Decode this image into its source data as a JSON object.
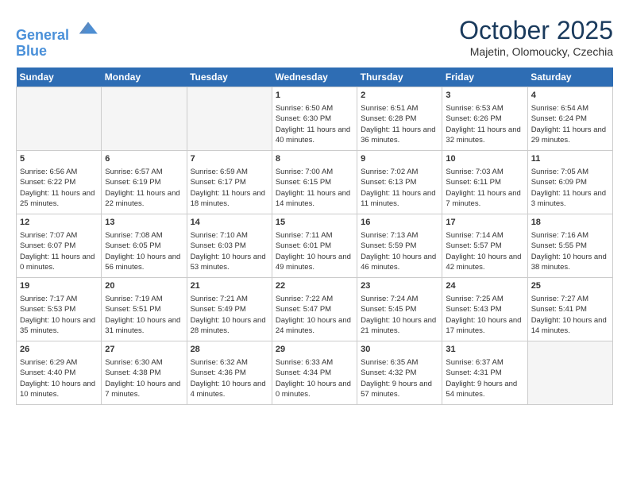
{
  "header": {
    "logo_line1": "General",
    "logo_line2": "Blue",
    "month": "October 2025",
    "location": "Majetin, Olomoucky, Czechia"
  },
  "weekdays": [
    "Sunday",
    "Monday",
    "Tuesday",
    "Wednesday",
    "Thursday",
    "Friday",
    "Saturday"
  ],
  "weeks": [
    [
      {
        "day": "",
        "info": ""
      },
      {
        "day": "",
        "info": ""
      },
      {
        "day": "",
        "info": ""
      },
      {
        "day": "1",
        "info": "Sunrise: 6:50 AM\nSunset: 6:30 PM\nDaylight: 11 hours and 40 minutes."
      },
      {
        "day": "2",
        "info": "Sunrise: 6:51 AM\nSunset: 6:28 PM\nDaylight: 11 hours and 36 minutes."
      },
      {
        "day": "3",
        "info": "Sunrise: 6:53 AM\nSunset: 6:26 PM\nDaylight: 11 hours and 32 minutes."
      },
      {
        "day": "4",
        "info": "Sunrise: 6:54 AM\nSunset: 6:24 PM\nDaylight: 11 hours and 29 minutes."
      }
    ],
    [
      {
        "day": "5",
        "info": "Sunrise: 6:56 AM\nSunset: 6:22 PM\nDaylight: 11 hours and 25 minutes."
      },
      {
        "day": "6",
        "info": "Sunrise: 6:57 AM\nSunset: 6:19 PM\nDaylight: 11 hours and 22 minutes."
      },
      {
        "day": "7",
        "info": "Sunrise: 6:59 AM\nSunset: 6:17 PM\nDaylight: 11 hours and 18 minutes."
      },
      {
        "day": "8",
        "info": "Sunrise: 7:00 AM\nSunset: 6:15 PM\nDaylight: 11 hours and 14 minutes."
      },
      {
        "day": "9",
        "info": "Sunrise: 7:02 AM\nSunset: 6:13 PM\nDaylight: 11 hours and 11 minutes."
      },
      {
        "day": "10",
        "info": "Sunrise: 7:03 AM\nSunset: 6:11 PM\nDaylight: 11 hours and 7 minutes."
      },
      {
        "day": "11",
        "info": "Sunrise: 7:05 AM\nSunset: 6:09 PM\nDaylight: 11 hours and 3 minutes."
      }
    ],
    [
      {
        "day": "12",
        "info": "Sunrise: 7:07 AM\nSunset: 6:07 PM\nDaylight: 11 hours and 0 minutes."
      },
      {
        "day": "13",
        "info": "Sunrise: 7:08 AM\nSunset: 6:05 PM\nDaylight: 10 hours and 56 minutes."
      },
      {
        "day": "14",
        "info": "Sunrise: 7:10 AM\nSunset: 6:03 PM\nDaylight: 10 hours and 53 minutes."
      },
      {
        "day": "15",
        "info": "Sunrise: 7:11 AM\nSunset: 6:01 PM\nDaylight: 10 hours and 49 minutes."
      },
      {
        "day": "16",
        "info": "Sunrise: 7:13 AM\nSunset: 5:59 PM\nDaylight: 10 hours and 46 minutes."
      },
      {
        "day": "17",
        "info": "Sunrise: 7:14 AM\nSunset: 5:57 PM\nDaylight: 10 hours and 42 minutes."
      },
      {
        "day": "18",
        "info": "Sunrise: 7:16 AM\nSunset: 5:55 PM\nDaylight: 10 hours and 38 minutes."
      }
    ],
    [
      {
        "day": "19",
        "info": "Sunrise: 7:17 AM\nSunset: 5:53 PM\nDaylight: 10 hours and 35 minutes."
      },
      {
        "day": "20",
        "info": "Sunrise: 7:19 AM\nSunset: 5:51 PM\nDaylight: 10 hours and 31 minutes."
      },
      {
        "day": "21",
        "info": "Sunrise: 7:21 AM\nSunset: 5:49 PM\nDaylight: 10 hours and 28 minutes."
      },
      {
        "day": "22",
        "info": "Sunrise: 7:22 AM\nSunset: 5:47 PM\nDaylight: 10 hours and 24 minutes."
      },
      {
        "day": "23",
        "info": "Sunrise: 7:24 AM\nSunset: 5:45 PM\nDaylight: 10 hours and 21 minutes."
      },
      {
        "day": "24",
        "info": "Sunrise: 7:25 AM\nSunset: 5:43 PM\nDaylight: 10 hours and 17 minutes."
      },
      {
        "day": "25",
        "info": "Sunrise: 7:27 AM\nSunset: 5:41 PM\nDaylight: 10 hours and 14 minutes."
      }
    ],
    [
      {
        "day": "26",
        "info": "Sunrise: 6:29 AM\nSunset: 4:40 PM\nDaylight: 10 hours and 10 minutes."
      },
      {
        "day": "27",
        "info": "Sunrise: 6:30 AM\nSunset: 4:38 PM\nDaylight: 10 hours and 7 minutes."
      },
      {
        "day": "28",
        "info": "Sunrise: 6:32 AM\nSunset: 4:36 PM\nDaylight: 10 hours and 4 minutes."
      },
      {
        "day": "29",
        "info": "Sunrise: 6:33 AM\nSunset: 4:34 PM\nDaylight: 10 hours and 0 minutes."
      },
      {
        "day": "30",
        "info": "Sunrise: 6:35 AM\nSunset: 4:32 PM\nDaylight: 9 hours and 57 minutes."
      },
      {
        "day": "31",
        "info": "Sunrise: 6:37 AM\nSunset: 4:31 PM\nDaylight: 9 hours and 54 minutes."
      },
      {
        "day": "",
        "info": ""
      }
    ]
  ]
}
